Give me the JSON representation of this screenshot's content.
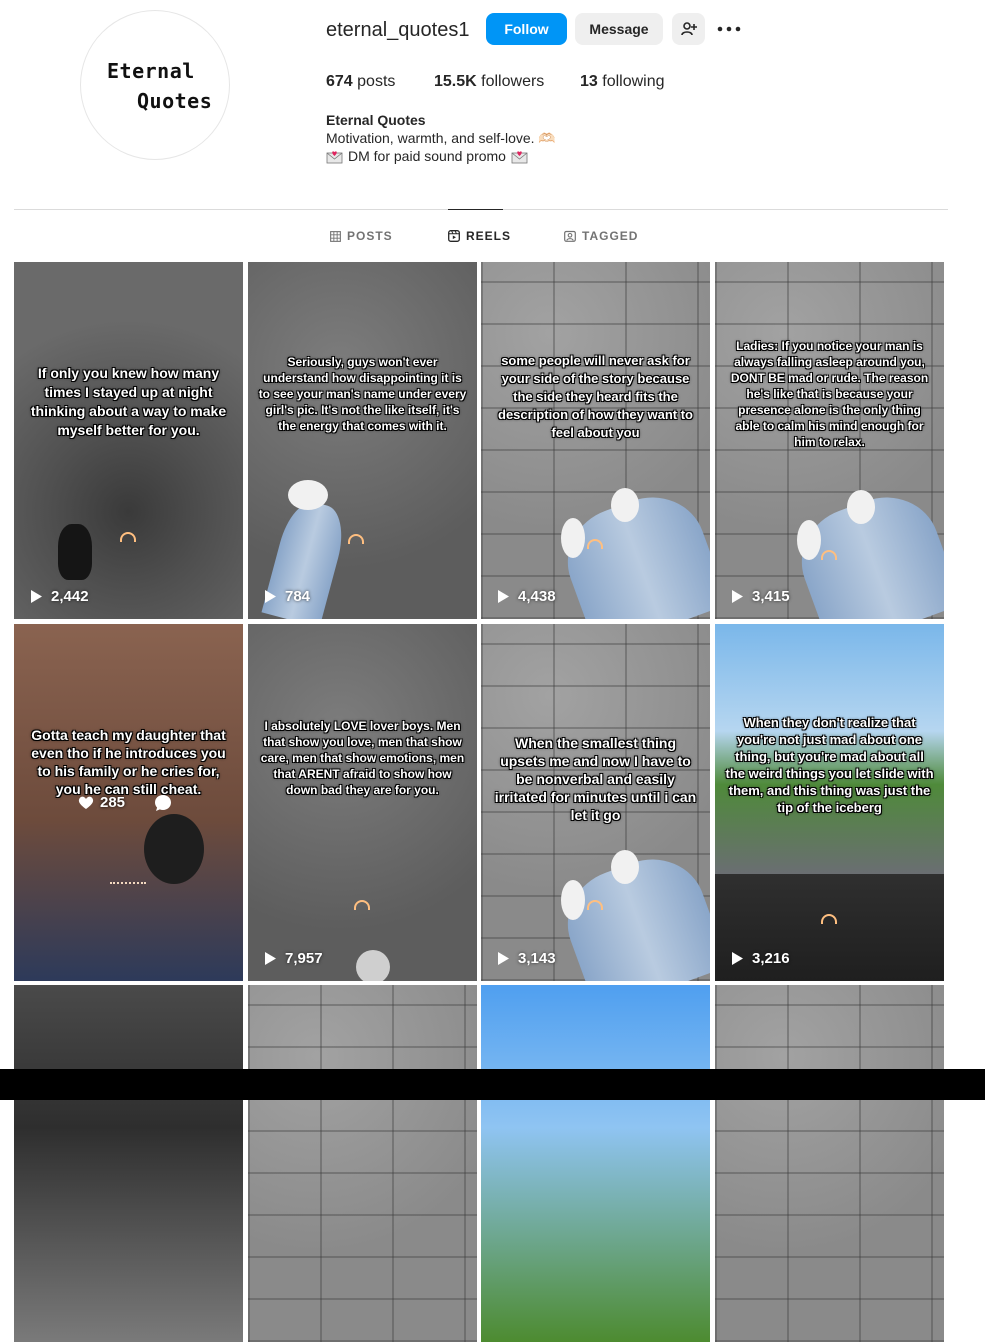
{
  "profile": {
    "avatar_line1": "Eternal",
    "avatar_line2": "Quotes",
    "username": "eternal_quotes1",
    "follow_label": "Follow",
    "message_label": "Message",
    "posts_count": "674",
    "posts_label": "posts",
    "followers_count": "15.5K",
    "followers_label": "followers",
    "following_count": "13",
    "following_label": "following",
    "bio_name": "Eternal Quotes",
    "bio_line1": "Motivation, warmth, and self-love. 🫶🏻",
    "bio_line2": "DM for paid sound promo"
  },
  "tabs": [
    {
      "label": "POSTS"
    },
    {
      "label": "REELS"
    },
    {
      "label": "TAGGED"
    }
  ],
  "colors": {
    "accent": "#0095f6",
    "secondary_button": "#efefef",
    "divider": "#dbdbdb"
  },
  "reels": [
    {
      "caption": "If only you knew how many times I stayed up at night thinking about a way to make myself better for you.",
      "views": "2,442"
    },
    {
      "caption": "Seriously, guys won't ever understand how disappointing it is to see your man's name under every girl's pic. It's not the like itself, it's the energy that comes with it.",
      "views": "784"
    },
    {
      "caption": "some people will never ask for your side of the story because the side they heard fits the description of how they want to feel about you",
      "views": "4,438"
    },
    {
      "caption": "Ladies: If you notice your man is always falling asleep around you, DONT BE mad or rude. The reason he's like that is because your presence alone is the only thing able to calm his mind enough for him to relax.",
      "views": "3,415"
    },
    {
      "caption": "Gotta teach my daughter that even tho if he introduces you to his family or he cries for, you he can still cheat.",
      "views": "285"
    },
    {
      "caption": "I absolutely LOVE lover boys. Men that show you love, men that show care, men that show emotions, men that ARENT afraid to show how down bad they are for you.",
      "views": "7,957"
    },
    {
      "caption": "When the smallest thing upsets me and now I have to be nonverbal and easily irritated for minutes until i can let it go",
      "views": "3,143"
    },
    {
      "caption": "When they don't realize that you're not just mad about one thing, but you're mad about all the weird things you let slide with them, and this thing was just the tip of the iceberg",
      "views": "3,216"
    }
  ]
}
